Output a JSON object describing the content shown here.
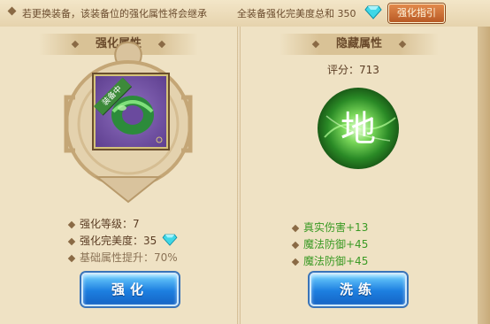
{
  "topbar": {
    "tip": "若更换装备，该装备位的强化属性将会继承",
    "total_label": "全装备强化完美度总和 350",
    "guide_button": "强化指引"
  },
  "left_panel": {
    "title": "强化属性",
    "item_badge": "装备中",
    "stats": [
      {
        "label": "强化等级：7"
      },
      {
        "label": "强化完美度：35"
      },
      {
        "label": "基础属性提升：70%"
      }
    ],
    "action_label": "强化"
  },
  "right_panel": {
    "title": "隐藏属性",
    "score": "评分：713",
    "orb_glyph": "地",
    "bonuses": [
      {
        "label": "真实伤害+13"
      },
      {
        "label": "魔法防御+45"
      },
      {
        "label": "魔法防御+45"
      }
    ],
    "action_label": "洗练"
  },
  "icons": {
    "gem": "cyan-diamond-icon",
    "item": "jade-ring-icon"
  },
  "colors": {
    "bonus_green": "#3a9a24",
    "button_blue": "#1d7fe0",
    "guide_orange": "#c86a30",
    "frame_purple": "#6a4a9e"
  }
}
